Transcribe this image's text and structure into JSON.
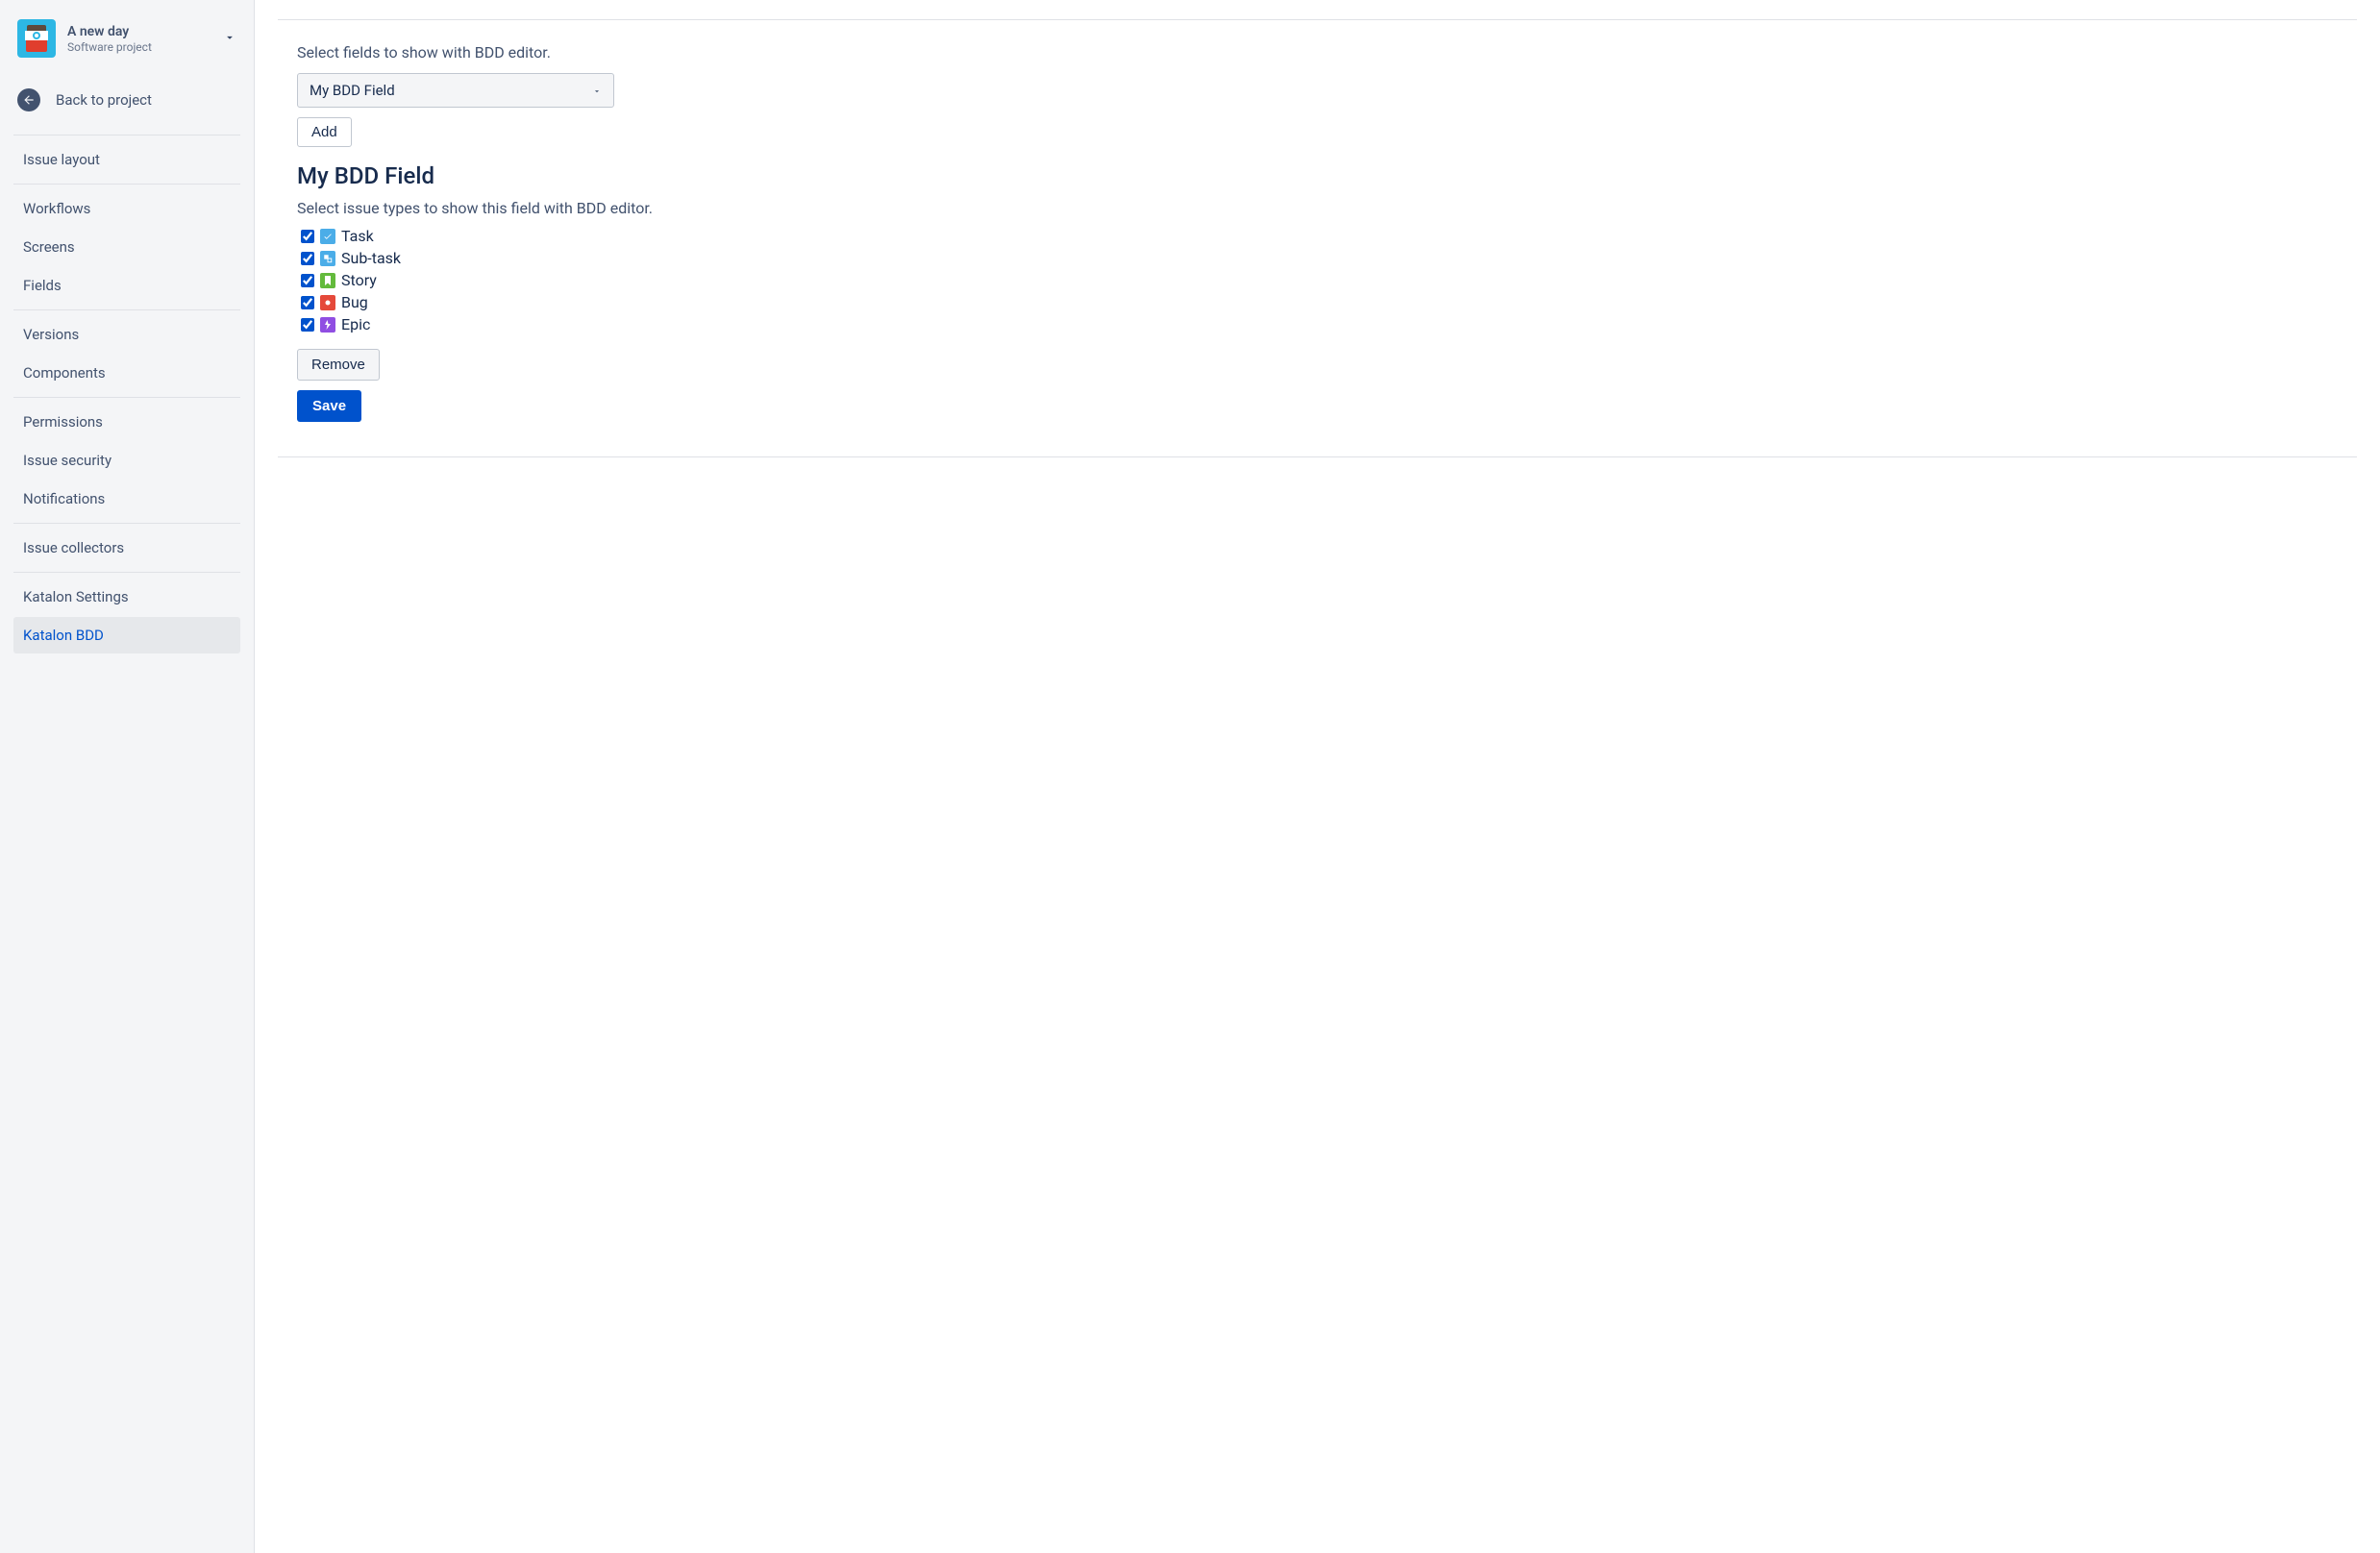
{
  "sidebar": {
    "project": {
      "name": "A new day",
      "type": "Software project"
    },
    "back_label": "Back to project",
    "nav_items": [
      {
        "label": "Issue layout",
        "active": false
      },
      {
        "label": "Workflows",
        "active": false
      },
      {
        "label": "Screens",
        "active": false
      },
      {
        "label": "Fields",
        "active": false
      },
      {
        "label": "Versions",
        "active": false
      },
      {
        "label": "Components",
        "active": false
      },
      {
        "label": "Permissions",
        "active": false
      },
      {
        "label": "Issue security",
        "active": false
      },
      {
        "label": "Notifications",
        "active": false
      },
      {
        "label": "Issue collectors",
        "active": false
      },
      {
        "label": "Katalon Settings",
        "active": false
      },
      {
        "label": "Katalon BDD",
        "active": true
      }
    ]
  },
  "main": {
    "field_instruction": "Select fields to show with BDD editor.",
    "dropdown": {
      "selected": "My BDD Field"
    },
    "add_button": "Add",
    "section_title": "My BDD Field",
    "issue_instruction": "Select issue types to show this field with BDD editor.",
    "issue_types": [
      {
        "label": "Task",
        "type": "task",
        "checked": true
      },
      {
        "label": "Sub-task",
        "type": "subtask",
        "checked": true
      },
      {
        "label": "Story",
        "type": "story",
        "checked": true
      },
      {
        "label": "Bug",
        "type": "bug",
        "checked": true
      },
      {
        "label": "Epic",
        "type": "epic",
        "checked": true
      }
    ],
    "remove_button": "Remove",
    "save_button": "Save"
  }
}
